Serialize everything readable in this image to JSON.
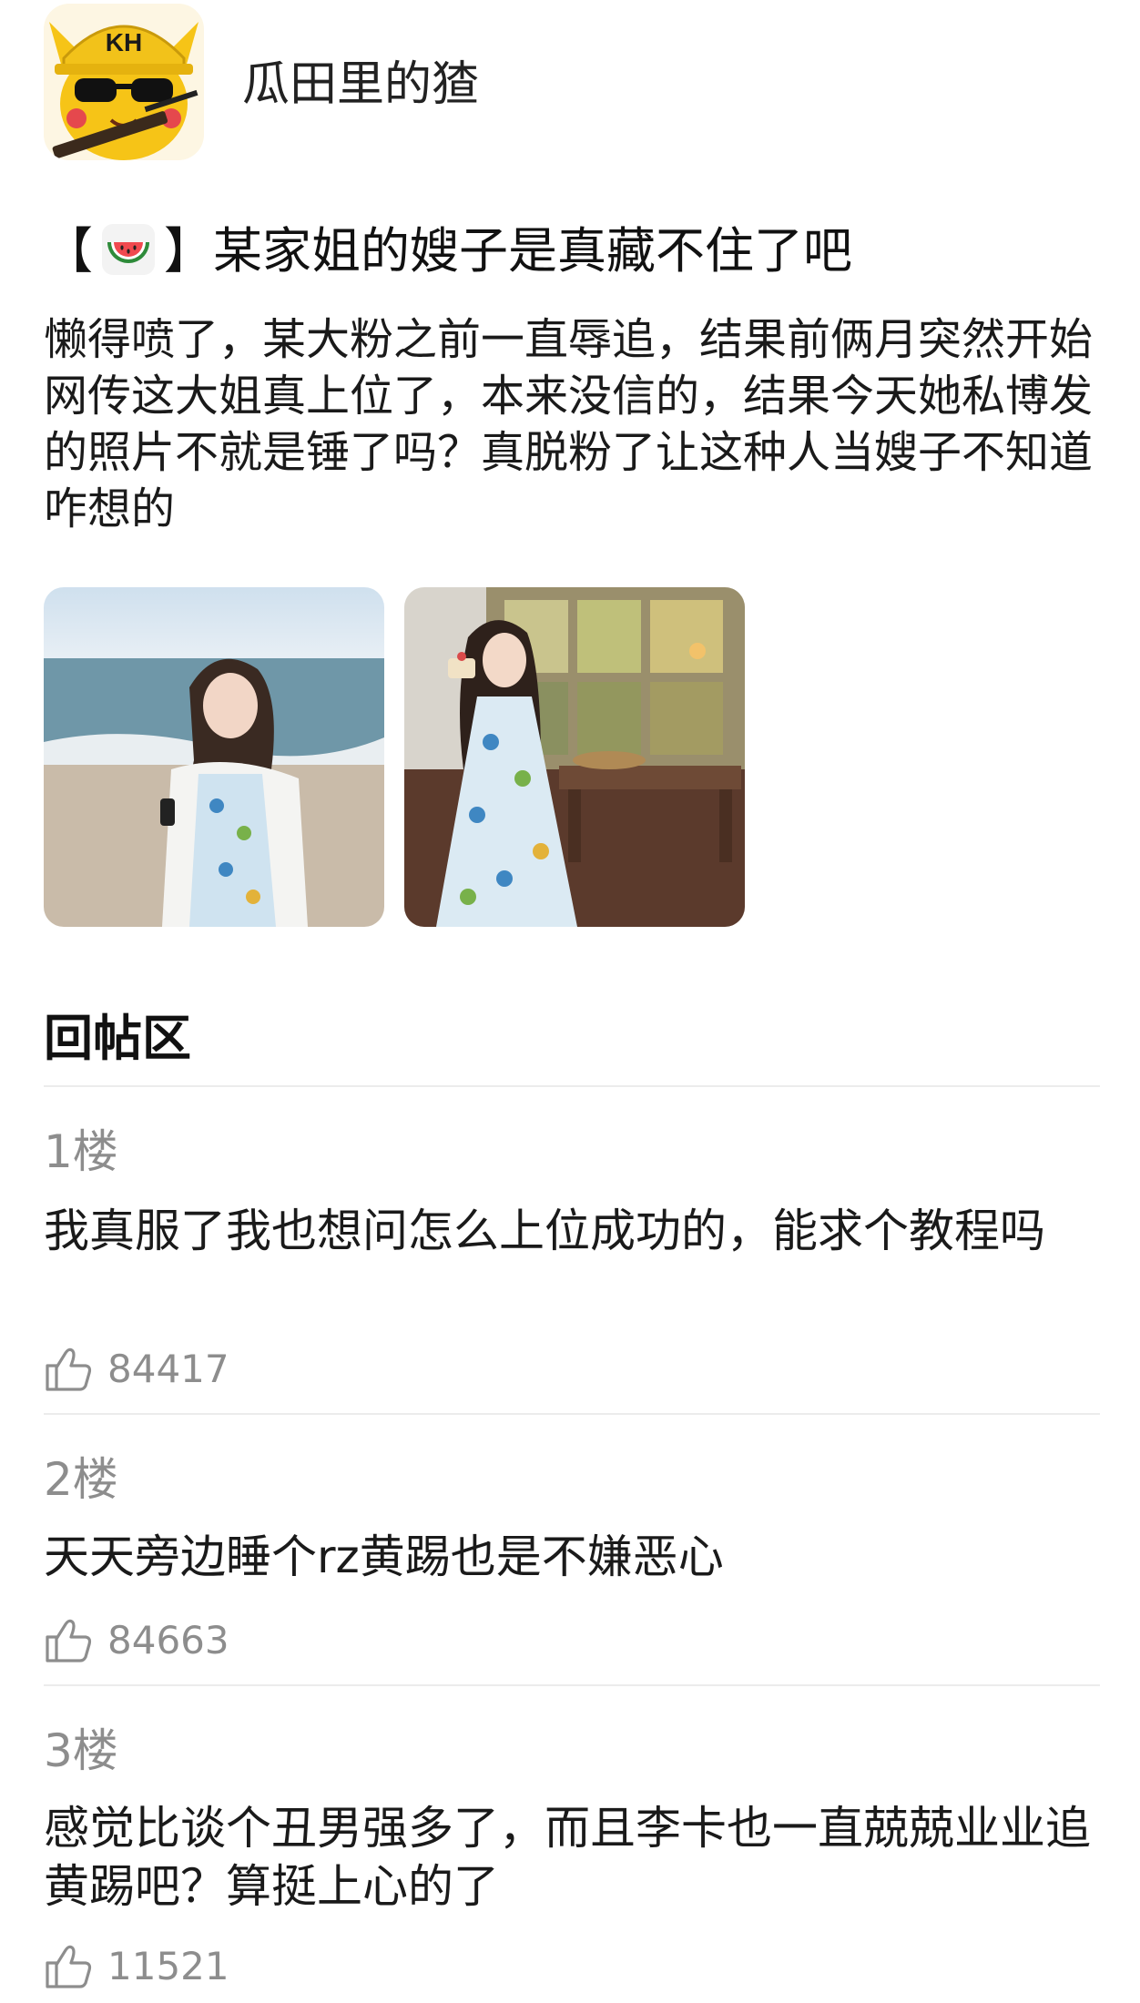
{
  "author": {
    "name": "瓜田里的猹",
    "avatar_icon": "pikachu-kh-avatar-icon",
    "avatar_badge": "KH"
  },
  "post": {
    "title_open": "【",
    "title_emoji": "watermelon-icon",
    "title_text": "】某家姐的嫂子是真藏不住了吧",
    "body": "懒得喷了，某大粉之前一直辱追，结果前俩月突然开始网传这大姐真上位了，本来没信的，结果今天她私博发的照片不就是锤了吗？真脱粉了让这种人当嫂子不知道咋想的",
    "photos": [
      {
        "icon": "photo-beach-girl-icon"
      },
      {
        "icon": "photo-cake-girl-icon"
      }
    ]
  },
  "replies_section": {
    "title": "回帖区"
  },
  "replies": [
    {
      "floor": "1楼",
      "text": "我真服了我也想问怎么上位成功的，能求个教程吗",
      "likes": "84417",
      "like_icon": "thumbs-up-icon"
    },
    {
      "floor": "2楼",
      "text": "天天旁边睡个rz黄踢也是不嫌恶心",
      "likes": "84663",
      "like_icon": "thumbs-up-icon"
    },
    {
      "floor": "3楼",
      "text": "感觉比谈个丑男强多了，而且李卡也一直兢兢业业追黄踢吧？算挺上心的了",
      "likes": "11521",
      "like_icon": "thumbs-up-icon"
    }
  ],
  "colors": {
    "text": "#1a1a1a",
    "muted": "#8d8d8d",
    "divider": "#ececec",
    "avatar_yellow": "#f6c417"
  }
}
